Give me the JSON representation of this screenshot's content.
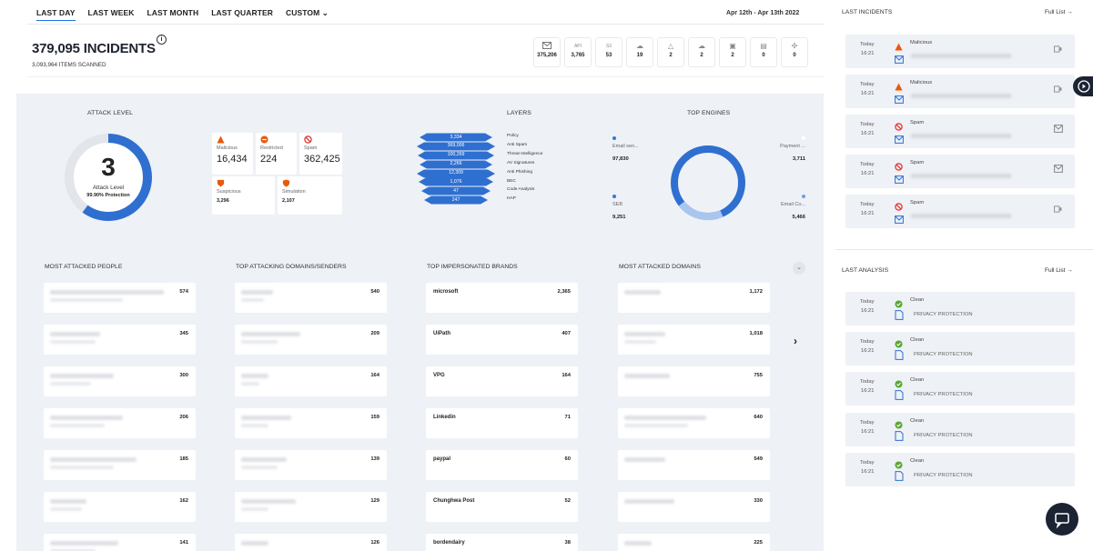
{
  "tabs": [
    {
      "label": "LAST DAY",
      "active": true
    },
    {
      "label": "LAST WEEK"
    },
    {
      "label": "LAST MONTH"
    },
    {
      "label": "LAST QUARTER"
    },
    {
      "label": "CUSTOM ⌄"
    }
  ],
  "date_range": "Apr 12th - Apr 13th 2022",
  "incidents": {
    "title": "379,095 INCIDENTS",
    "scanned": "3,093,964 ITEMS SCANNED"
  },
  "channels": [
    {
      "icon": "mail-icon",
      "label": "",
      "value": "375,206"
    },
    {
      "icon": "api-icon",
      "label": "API",
      "value": "3,765"
    },
    {
      "icon": "s3-icon",
      "label": "S3",
      "value": "53"
    },
    {
      "icon": "cloud-icon",
      "label": "",
      "value": "19"
    },
    {
      "icon": "drive-icon",
      "label": "",
      "value": "2"
    },
    {
      "icon": "chat-icon",
      "label": "",
      "value": "2"
    },
    {
      "icon": "teams-icon",
      "label": "",
      "value": "2"
    },
    {
      "icon": "slack-icon",
      "label": "",
      "value": "0"
    },
    {
      "icon": "settings-icon",
      "label": "",
      "value": "0"
    }
  ],
  "attack_level": {
    "title": "ATTACK LEVEL",
    "value": "3",
    "label": "Attack Level",
    "protection": "99.90% Protection",
    "fill_fraction": 0.6
  },
  "categories": {
    "malicious": {
      "label": "Malicious",
      "value": "16,434"
    },
    "restricted": {
      "label": "Restricted",
      "value": "224"
    },
    "spam": {
      "label": "Spam",
      "value": "362,425"
    },
    "suspicious": {
      "label": "Suspicious",
      "value": "3,296"
    },
    "simulation": {
      "label": "Simulation",
      "value": "2,107"
    }
  },
  "layers": {
    "title": "LAYERS",
    "items": [
      {
        "value": "3,334",
        "label": "Policy"
      },
      {
        "value": "369,006",
        "label": "Anti Spam"
      },
      {
        "value": "100,269",
        "label": "Threat Intelligence"
      },
      {
        "value": "2,266",
        "label": "AV Signatures"
      },
      {
        "value": "12,309",
        "label": "Anti Phishing"
      },
      {
        "value": "1,076",
        "label": "BEC"
      },
      {
        "value": "47",
        "label": "Code Analysis"
      },
      {
        "value": "247",
        "label": "HAP"
      }
    ]
  },
  "top_engines": {
    "title": "TOP ENGINES",
    "engines": [
      {
        "name": "Email sen...",
        "value": "97,830"
      },
      {
        "name": "Payment ...",
        "value": "3,711"
      },
      {
        "name": "SEB",
        "value": "9,251"
      },
      {
        "name": "Email Co...",
        "value": "5,466"
      }
    ]
  },
  "most_attacked_people": {
    "title": "MOST ATTACKED PEOPLE",
    "values": [
      "574",
      "345",
      "300",
      "206",
      "185",
      "162",
      "141"
    ]
  },
  "top_attacking": {
    "title": "TOP ATTACKING DOMAINS/SENDERS",
    "values": [
      "540",
      "209",
      "164",
      "159",
      "139",
      "129",
      "126"
    ]
  },
  "top_brands": {
    "title": "TOP IMPERSONATED BRANDS",
    "items": [
      {
        "name": "microsoft",
        "value": "2,365"
      },
      {
        "name": "UiPath",
        "value": "407"
      },
      {
        "name": "VPG",
        "value": "164"
      },
      {
        "name": "Linkedin",
        "value": "71"
      },
      {
        "name": "paypal",
        "value": "60"
      },
      {
        "name": "Chunghwa Post",
        "value": "52"
      },
      {
        "name": "bordendairy",
        "value": "38"
      }
    ]
  },
  "most_attacked_domains": {
    "title": "MOST ATTACKED DOMAINS",
    "values": [
      "1,172",
      "1,018",
      "755",
      "640",
      "549",
      "330",
      "225"
    ]
  },
  "last_incidents": {
    "title": "LAST INCIDENTS",
    "full_list": "Full List →",
    "items": [
      {
        "day": "Today",
        "time": "16:21",
        "type": "Malicious"
      },
      {
        "day": "Today",
        "time": "16:21",
        "type": "Malicious"
      },
      {
        "day": "Today",
        "time": "16:21",
        "type": "Spam"
      },
      {
        "day": "Today",
        "time": "16:21",
        "type": "Spam"
      },
      {
        "day": "Today",
        "time": "16:21",
        "type": "Spam"
      }
    ]
  },
  "last_analysis": {
    "title": "LAST ANALYSIS",
    "full_list": "Full List →",
    "items": [
      {
        "day": "Today",
        "time": "16:21",
        "status": "Clean",
        "detail": "PRIVACY PROTECTION"
      },
      {
        "day": "Today",
        "time": "16:21",
        "status": "Clean",
        "detail": "PRIVACY PROTECTION"
      },
      {
        "day": "Today",
        "time": "16:21",
        "status": "Clean",
        "detail": "PRIVACY PROTECTION"
      },
      {
        "day": "Today",
        "time": "16:21",
        "status": "Clean",
        "detail": "PRIVACY PROTECTION"
      },
      {
        "day": "Today",
        "time": "16:21",
        "status": "Clean",
        "detail": "PRIVACY PROTECTION"
      }
    ]
  },
  "colors": {
    "accent": "#2f6fd0",
    "malicious": "#e8590c",
    "spam": "#e03131",
    "clean": "#5aa832",
    "panel": "#eef1f6"
  }
}
